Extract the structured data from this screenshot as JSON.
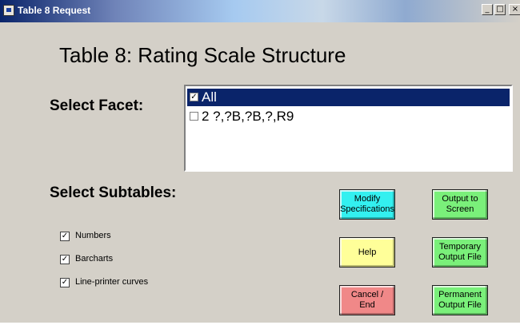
{
  "window": {
    "title": "Table 8 Request",
    "minimize_glyph": "_",
    "maximize_glyph": "□",
    "close_glyph": "×"
  },
  "heading": "Table 8: Rating Scale Structure",
  "facet": {
    "label": "Select Facet:",
    "items": [
      {
        "label": "All",
        "checked": true,
        "selected": true
      },
      {
        "label": "2 ?,?B,?B,?,R9",
        "checked": false,
        "selected": false
      }
    ]
  },
  "subtables": {
    "label": "Select Subtables:",
    "options": [
      {
        "label": "Numbers",
        "checked": true
      },
      {
        "label": "Barcharts",
        "checked": true
      },
      {
        "label": "Line-printer curves",
        "checked": true
      }
    ]
  },
  "buttons": {
    "modify": {
      "label": "Modify Specifications",
      "color": "#33f0f0"
    },
    "output_screen": {
      "label": "Output to Screen",
      "color": "#7af07a"
    },
    "help": {
      "label": "Help",
      "color": "#ffff99"
    },
    "temporary": {
      "label": "Temporary Output File",
      "color": "#7af07a"
    },
    "cancel": {
      "label": "Cancel / End",
      "color": "#f08888"
    },
    "permanent": {
      "label": "Permanent Output File",
      "color": "#7af07a"
    }
  },
  "check_glyph": "✓"
}
